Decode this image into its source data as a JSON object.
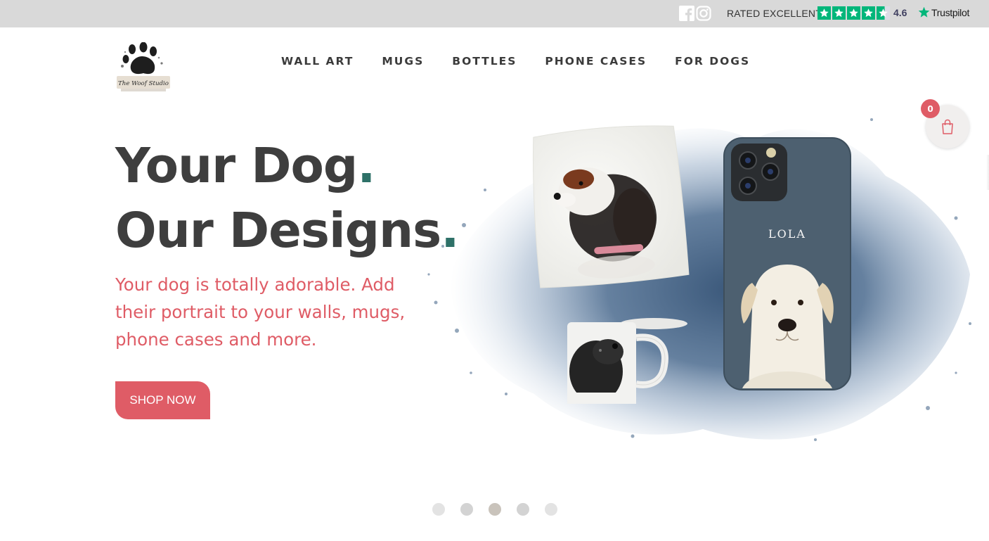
{
  "topbar": {
    "rating_label": "RATED EXCELLENT",
    "rating_score": "4.6",
    "rating_stars": 4.6,
    "trustpilot_label": "Trustpilot",
    "icons": [
      "facebook-icon",
      "instagram-icon"
    ],
    "trustpilot_green": "#00b67a"
  },
  "header": {
    "logo_text": "The Woof Studio",
    "nav": [
      {
        "label": "WALL ART"
      },
      {
        "label": "MUGS"
      },
      {
        "label": "BOTTLES"
      },
      {
        "label": "PHONE CASES"
      },
      {
        "label": "FOR DOGS"
      }
    ]
  },
  "cart": {
    "count": "0",
    "icon": "shopping-bag-icon"
  },
  "hero": {
    "headline_line1": "Your Dog",
    "headline_line2": "Our Designs",
    "headline_dot": ".",
    "subtitle": "Your dog is totally adorable. Add their portrait to your walls, mugs, phone cases and more.",
    "cta_label": "SHOP NOW",
    "phone_case_name": "LOLA"
  },
  "slider": {
    "count": 5,
    "active_index": 2
  },
  "colors": {
    "accent": "#df5c66",
    "dot_teal": "#2e7168",
    "text_dark": "#3e3e3e",
    "topbar_bg": "#d9d9d9",
    "splash_blue": "#4a6a8e"
  }
}
